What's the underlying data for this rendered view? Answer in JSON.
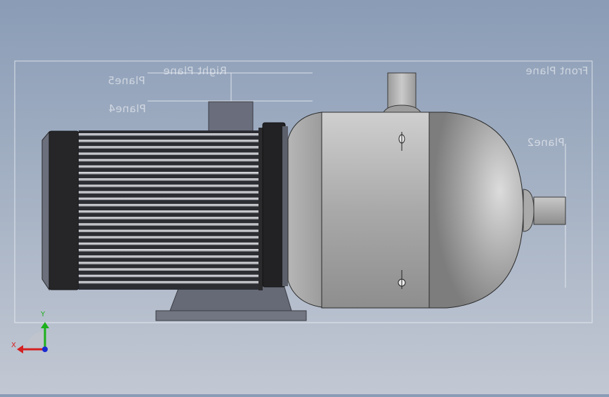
{
  "viewport": {
    "colors": {
      "background_top": "#8a9cb6",
      "background_bottom": "#c2c8d3",
      "motor_body": "#2a2a2d",
      "motor_fins": "#4a4d55",
      "pump_casing": "#a8a8a8",
      "plane_outline": "#e8ecf2"
    }
  },
  "planes": {
    "front": "Front Plane",
    "right": "Right Plane",
    "plane2": "Plane2",
    "plane4": "Plane4",
    "plane5": "Plane5"
  },
  "triad": {
    "x_label": "X",
    "y_label": "Y",
    "x_color": "#d42020",
    "y_color": "#1cb01c",
    "z_color": "#1a2ad0"
  },
  "model": {
    "icons": [
      "electric-motor",
      "pump-casing",
      "outlet-nozzle",
      "inlet-nozzle",
      "mounting-foot"
    ]
  }
}
